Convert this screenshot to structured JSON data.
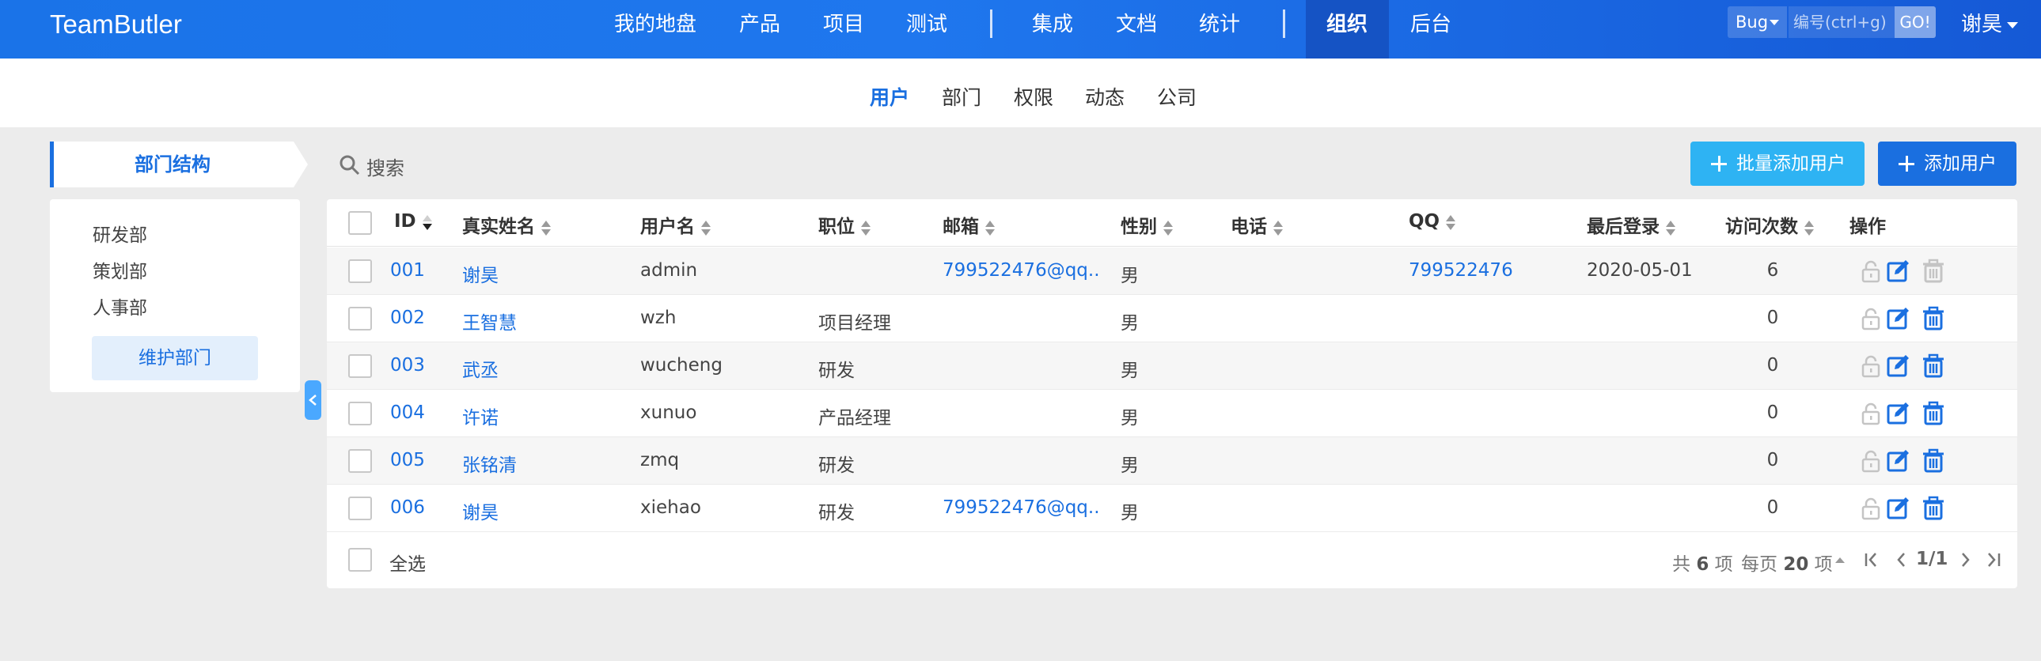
{
  "topnav": {
    "brand": "TeamButler",
    "items": [
      "我的地盘",
      "产品",
      "项目",
      "测试",
      "集成",
      "文档",
      "统计",
      "组织",
      "后台"
    ],
    "active": "组织",
    "bug_select": "Bug",
    "search_placeholder": "编号(ctrl+g)",
    "go_label": "GO!",
    "user_name": "谢昊"
  },
  "subnav": {
    "items": [
      "用户",
      "部门",
      "权限",
      "动态",
      "公司"
    ],
    "active": "用户"
  },
  "sidebar": {
    "title": "部门结构",
    "departments": [
      "研发部",
      "策划部",
      "人事部"
    ],
    "maintain_label": "维护部门"
  },
  "toolbar": {
    "search_label": "搜索",
    "batch_add_label": "批量添加用户",
    "add_label": "添加用户"
  },
  "table": {
    "columns": [
      "ID",
      "真实姓名",
      "用户名",
      "职位",
      "邮箱",
      "性别",
      "电话",
      "QQ",
      "最后登录",
      "访问次数",
      "操作"
    ],
    "rows": [
      {
        "id": "001",
        "realname": "谢昊",
        "username": "admin",
        "role": "",
        "email": "799522476@qq....",
        "gender": "男",
        "phone": "",
        "qq": "799522476",
        "last_login": "2020-05-01",
        "visits": "6",
        "deletable": false
      },
      {
        "id": "002",
        "realname": "王智慧",
        "username": "wzh",
        "role": "项目经理",
        "email": "",
        "gender": "男",
        "phone": "",
        "qq": "",
        "last_login": "",
        "visits": "0",
        "deletable": true
      },
      {
        "id": "003",
        "realname": "武丞",
        "username": "wucheng",
        "role": "研发",
        "email": "",
        "gender": "男",
        "phone": "",
        "qq": "",
        "last_login": "",
        "visits": "0",
        "deletable": true
      },
      {
        "id": "004",
        "realname": "许诺",
        "username": "xunuo",
        "role": "产品经理",
        "email": "",
        "gender": "男",
        "phone": "",
        "qq": "",
        "last_login": "",
        "visits": "0",
        "deletable": true
      },
      {
        "id": "005",
        "realname": "张铭清",
        "username": "zmq",
        "role": "研发",
        "email": "",
        "gender": "男",
        "phone": "",
        "qq": "",
        "last_login": "",
        "visits": "0",
        "deletable": true
      },
      {
        "id": "006",
        "realname": "谢昊",
        "username": "xiehao",
        "role": "研发",
        "email": "799522476@qq....",
        "gender": "男",
        "phone": "",
        "qq": "",
        "last_login": "",
        "visits": "0",
        "deletable": true
      }
    ],
    "select_all_label": "全选"
  },
  "pager": {
    "total_prefix": "共",
    "total": "6",
    "total_suffix": "项",
    "per_page_prefix": "每页",
    "per_page": "20",
    "per_page_suffix": "项",
    "page": "1/1"
  },
  "colors": {
    "brand_blue": "#1a6fe0",
    "nav_gradient_start": "#1a73e8",
    "nav_gradient_end": "#1559d6",
    "batch_button": "#2eb3f3",
    "link": "#1a6fe0"
  }
}
